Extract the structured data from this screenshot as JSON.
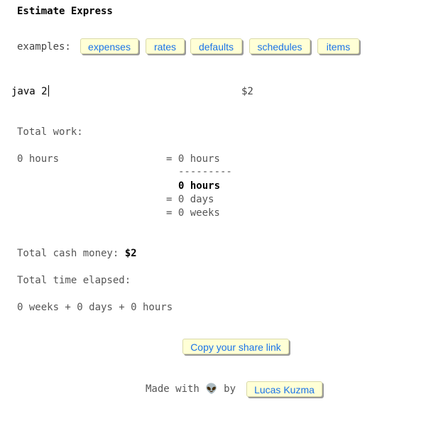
{
  "app": {
    "title": "Estimate Express"
  },
  "examples": {
    "label": "examples:",
    "items": [
      "expenses",
      "rates",
      "defaults",
      "schedules",
      "items"
    ]
  },
  "editor": {
    "line_text": "java 2",
    "line_amount": "$2"
  },
  "summary": {
    "total_work_label": "Total work:",
    "work_item": "0 hours",
    "eq1": "= 0 hours",
    "divider": "---------",
    "total_hours": "0 hours",
    "eq_days": "= 0 days",
    "eq_weeks": "= 0 weeks",
    "cash_label": "Total cash money:",
    "cash_value": "$2",
    "elapsed_label": "Total time elapsed:",
    "elapsed_value": "0 weeks + 0 days + 0 hours"
  },
  "share": {
    "button_label": "Copy your share link"
  },
  "footer": {
    "made_with": "Made with",
    "emoji": "👽",
    "by": "by",
    "author_link": "Lucas Kuzma"
  }
}
